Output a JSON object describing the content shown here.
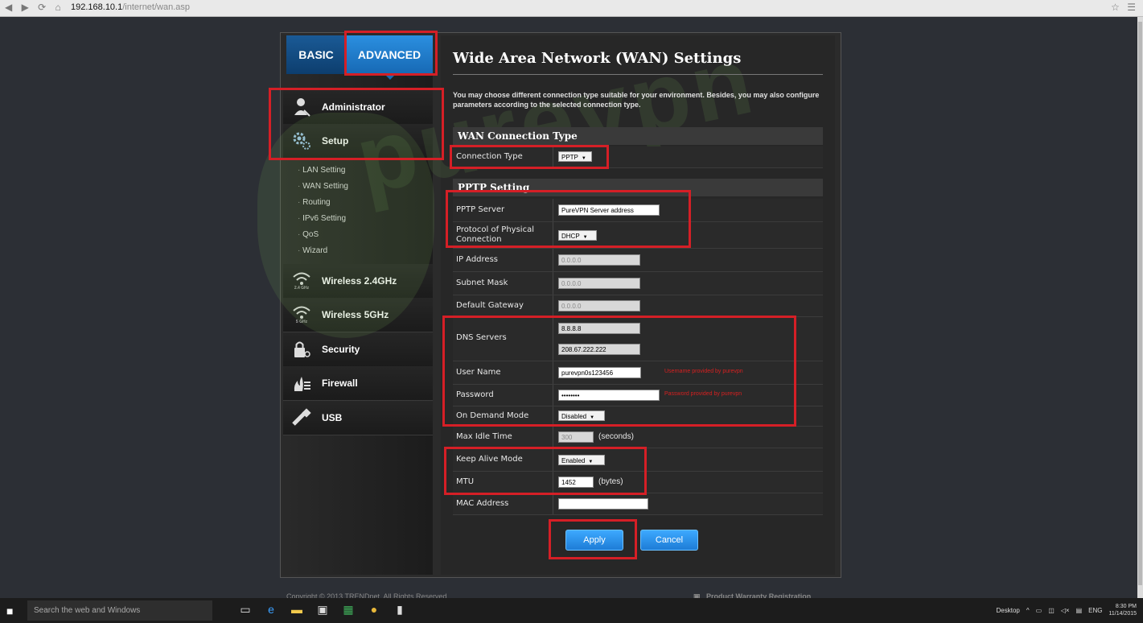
{
  "browser": {
    "url_host": "192.168.10.1",
    "url_path": "/internet/wan.asp"
  },
  "tabs": {
    "basic": "BASIC",
    "advanced": "ADVANCED"
  },
  "sidebar": {
    "items": [
      {
        "label": "Administrator",
        "icon": "admin-icon"
      },
      {
        "label": "Setup",
        "icon": "gear-icon"
      },
      {
        "label": "Wireless 2.4GHz",
        "icon": "wifi-icon"
      },
      {
        "label": "Wireless 5GHz",
        "icon": "wifi-icon"
      },
      {
        "label": "Security",
        "icon": "lock-icon"
      },
      {
        "label": "Firewall",
        "icon": "firewall-icon"
      },
      {
        "label": "USB",
        "icon": "usb-icon"
      }
    ],
    "wifi24_sub": "2.4 GHz",
    "wifi5_sub": "5 GHz",
    "setup_sub": [
      "LAN Setting",
      "WAN Setting",
      "Routing",
      "IPv6 Setting",
      "QoS",
      "Wizard"
    ]
  },
  "page": {
    "title": "Wide Area Network (WAN) Settings",
    "description": "You may choose different connection type suitable for your environment. Besides, you may also configure parameters according to the selected connection type."
  },
  "wan": {
    "section": "WAN Connection Type",
    "connection_type_label": "Connection Type",
    "connection_type_value": "PPTP"
  },
  "pptp": {
    "section": "PPTP Setting",
    "server_label": "PPTP Server",
    "server_value": "PureVPN Server address",
    "protocol_label": "Protocol of Physical Connection",
    "protocol_value": "DHCP",
    "ip_label": "IP Address",
    "ip_value": "0.0.0.0",
    "mask_label": "Subnet Mask",
    "mask_value": "0.0.0.0",
    "gateway_label": "Default Gateway",
    "gateway_value": "0.0.0.0",
    "dns_label": "DNS Servers",
    "dns1": "8.8.8.8",
    "dns2": "208.67.222.222",
    "user_label": "User Name",
    "user_value": "purevpn0s123456",
    "user_hint": "Username provided by purevpn",
    "pass_label": "Password",
    "pass_value": "••••••••",
    "pass_hint": "Password provided by purevpn",
    "ondemand_label": "On Demand Mode",
    "ondemand_value": "Disabled",
    "idle_label": "Max Idle Time",
    "idle_value": "300",
    "idle_unit": "(seconds)",
    "keepalive_label": "Keep Alive Mode",
    "keepalive_value": "Enabled",
    "mtu_label": "MTU",
    "mtu_value": "1452",
    "mtu_unit": "(bytes)",
    "mac_label": "MAC Address",
    "mac_value": ""
  },
  "buttons": {
    "apply": "Apply",
    "cancel": "Cancel"
  },
  "footer": {
    "copyright": "Copyright © 2013 TRENDnet. All Rights Reserved.",
    "warranty": "Product Warranty Registration"
  },
  "watermark": "purevpn",
  "taskbar": {
    "search_placeholder": "Search the web and Windows",
    "desktop_label": "Desktop",
    "language": "ENG",
    "time": "8:30 PM",
    "date": "11/14/2015"
  },
  "colors": {
    "accent": "#1d7cd6",
    "highlight": "#d51f26"
  }
}
